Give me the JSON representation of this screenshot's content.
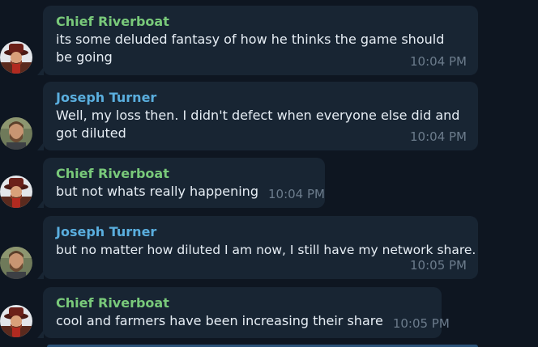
{
  "colors": {
    "background": "#0e1621",
    "bubble": "#182533",
    "author_chief": "#79c97a",
    "author_joseph": "#5aaede",
    "text": "#e7eef5",
    "timestamp": "#6c7c8c"
  },
  "messages": [
    {
      "author": "Chief Riverboat",
      "text": "its some deluded fantasy of how he thinks the game should be going",
      "time": "10:04 PM"
    },
    {
      "author": "Joseph Turner",
      "text": "Well, my loss then. I didn't defect when everyone else did and got diluted",
      "time": "10:04 PM"
    },
    {
      "author": "Chief Riverboat",
      "text": "but not whats really happening",
      "time": "10:04 PM"
    },
    {
      "author": "Joseph Turner",
      "text": "but no matter how diluted I am now, I still have my network share.",
      "time": "10:05 PM"
    },
    {
      "author": "Chief Riverboat",
      "text": "cool and farmers have been increasing their share",
      "time": "10:05 PM"
    }
  ]
}
